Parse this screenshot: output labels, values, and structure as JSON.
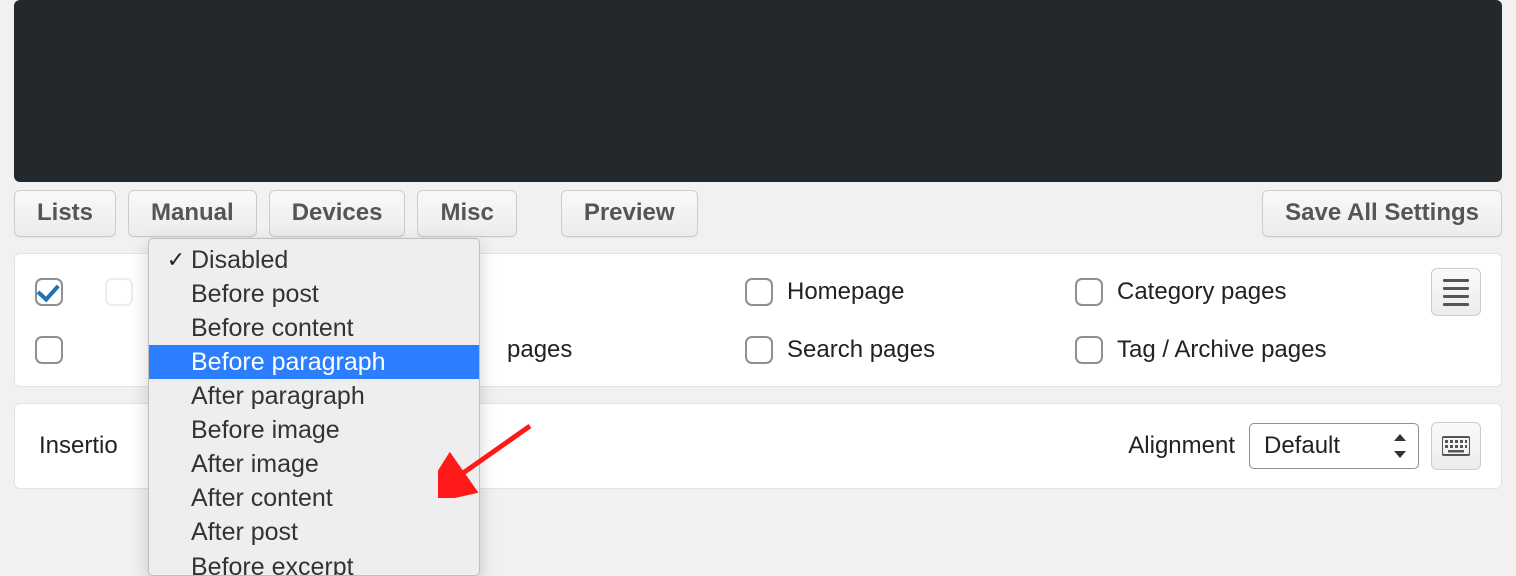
{
  "toolbar": {
    "lists": "Lists",
    "manual": "Manual",
    "devices": "Devices",
    "misc": "Misc",
    "preview": "Preview",
    "save": "Save All Settings"
  },
  "pages": {
    "static_pages": "pages",
    "homepage": "Homepage",
    "category": "Category pages",
    "search": "Search pages",
    "tag": "Tag / Archive pages"
  },
  "insertion": {
    "label": "Insertio",
    "alignment_label": "Alignment",
    "alignment_value": "Default"
  },
  "dropdown": {
    "items": [
      "Disabled",
      "Before post",
      "Before content",
      "Before paragraph",
      "After paragraph",
      "Before image",
      "After image",
      "After content",
      "After post",
      "Before excerpt"
    ],
    "checked_index": 0,
    "highlight_index": 3
  }
}
